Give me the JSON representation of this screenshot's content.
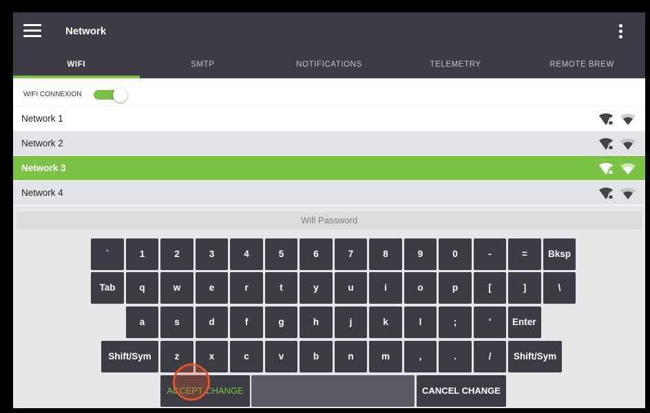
{
  "appbar": {
    "title": "Network",
    "menu_icon": "hamburger-menu-icon",
    "overflow_icon": "vertical-ellipsis-icon"
  },
  "tabs": [
    {
      "label": "WIFI",
      "active": true
    },
    {
      "label": "SMTP",
      "active": false
    },
    {
      "label": "NOTIFICATIONS",
      "active": false
    },
    {
      "label": "TELEMETRY",
      "active": false
    },
    {
      "label": "REMOTE BREW",
      "active": false
    }
  ],
  "wifi": {
    "toggle_label": "WIFI CONNEXION",
    "toggle_on": true
  },
  "networks": [
    {
      "name": "Network 1",
      "selected": false
    },
    {
      "name": "Network 2",
      "selected": false
    },
    {
      "name": "Network 3",
      "selected": true
    },
    {
      "name": "Network 4",
      "selected": false
    }
  ],
  "keyboard": {
    "password_placeholder": "Wifi Password",
    "row1": [
      "`",
      "1",
      "2",
      "3",
      "4",
      "5",
      "6",
      "7",
      "8",
      "9",
      "0",
      "-",
      "=",
      "Bksp"
    ],
    "row2": [
      "Tab",
      "q",
      "w",
      "e",
      "r",
      "t",
      "y",
      "u",
      "i",
      "o",
      "p",
      "[",
      "]",
      "\\"
    ],
    "row3": [
      "a",
      "s",
      "d",
      "f",
      "g",
      "h",
      "j",
      "k",
      "l",
      ";",
      "'",
      "Enter"
    ],
    "row4": [
      "Shift/Sym",
      "z",
      "x",
      "c",
      "v",
      "b",
      "n",
      "m",
      ",",
      ".",
      "/",
      "Shift/Sym"
    ],
    "accept": "ACCEPT CHANGE",
    "space": "",
    "cancel": "CANCEL CHANGE"
  },
  "colors": {
    "accent": "#7cc245",
    "bar": "#3d3b44",
    "touch": "#e2552b"
  }
}
